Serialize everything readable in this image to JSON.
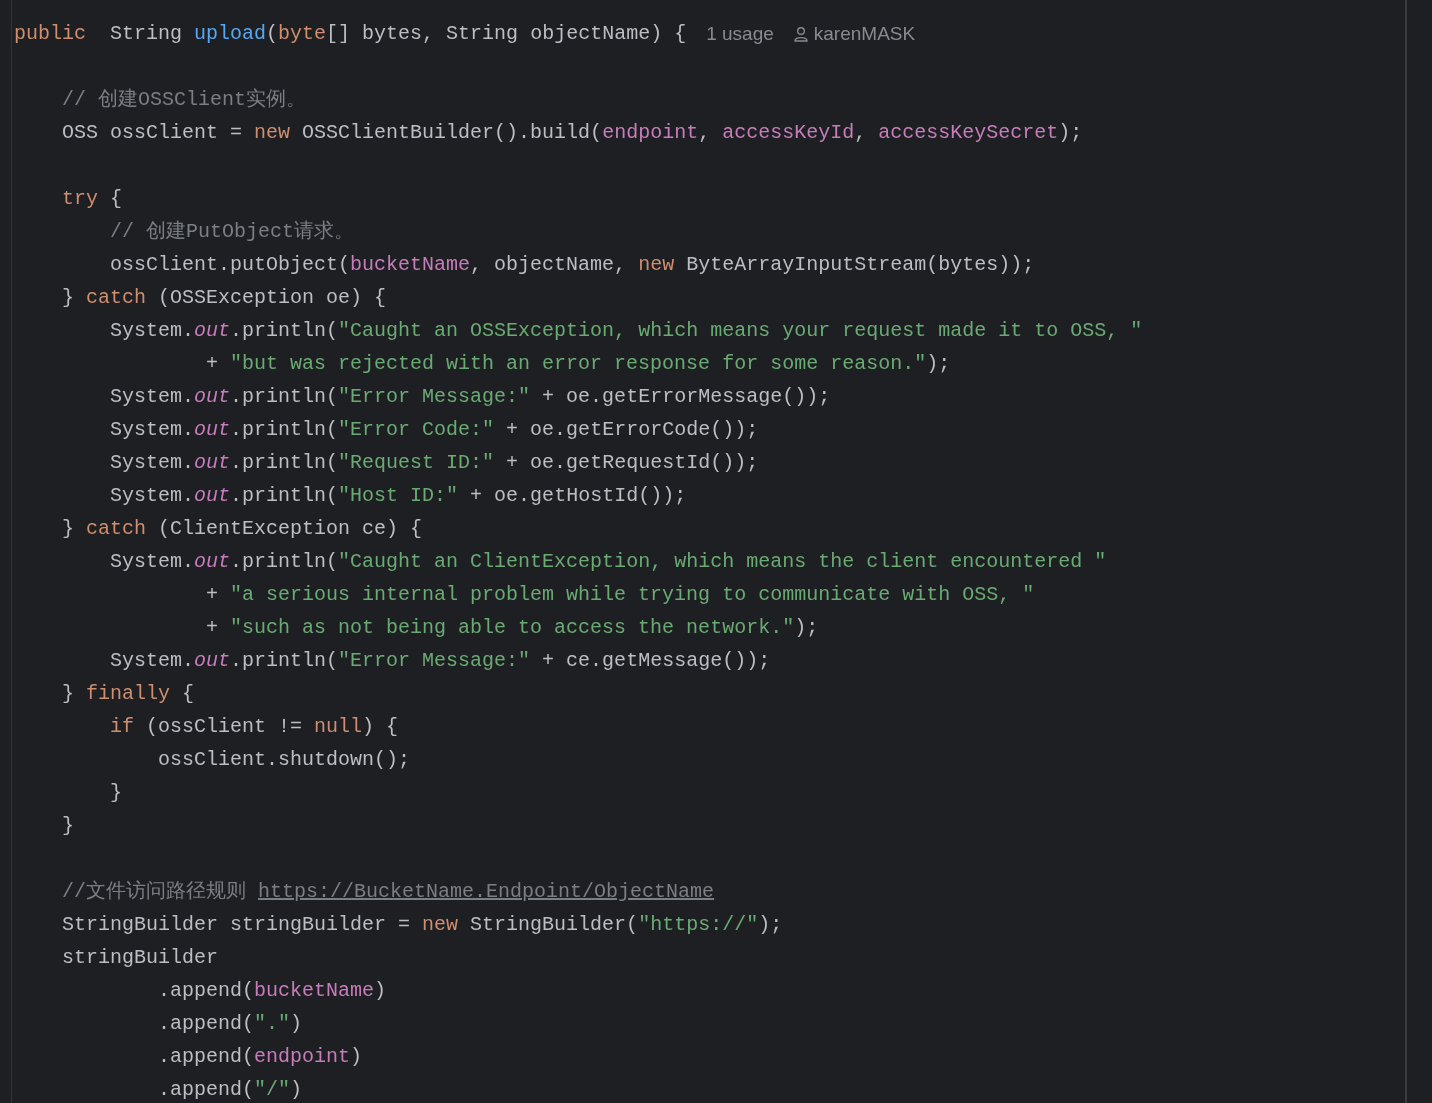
{
  "editor": {
    "blocks": [
      {
        "lines": [
          {
            "tokens": [
              {
                "kind": "keyword",
                "text": "public"
              },
              {
                "kind": "plain",
                "text": "  String "
              },
              {
                "kind": "method",
                "text": "upload"
              },
              {
                "kind": "plain",
                "text": "("
              },
              {
                "kind": "keyword",
                "text": "byte"
              },
              {
                "kind": "plain",
                "text": "[] bytes, String objectName) {"
              }
            ],
            "usage_hint": "1 usage",
            "author_hint": "karenMASK"
          }
        ]
      },
      {
        "lines": [
          {
            "tokens": [
              {
                "kind": "comment",
                "text": "    // 创建OSSClient实例。"
              }
            ]
          },
          {
            "tokens": [
              {
                "kind": "plain",
                "text": "    OSS ossClient = "
              },
              {
                "kind": "keyword",
                "text": "new"
              },
              {
                "kind": "plain",
                "text": " OSSClientBuilder().build("
              },
              {
                "kind": "field",
                "text": "endpoint"
              },
              {
                "kind": "plain",
                "text": ", "
              },
              {
                "kind": "field",
                "text": "accessKeyId"
              },
              {
                "kind": "plain",
                "text": ", "
              },
              {
                "kind": "field",
                "text": "accessKeySecret"
              },
              {
                "kind": "plain",
                "text": ");"
              }
            ]
          }
        ]
      },
      {
        "lines": [
          {
            "tokens": [
              {
                "kind": "keyword",
                "text": "    try"
              },
              {
                "kind": "plain",
                "text": " {"
              }
            ]
          },
          {
            "tokens": [
              {
                "kind": "comment",
                "text": "        // 创建PutObject请求。"
              }
            ]
          },
          {
            "tokens": [
              {
                "kind": "plain",
                "text": "        ossClient.putObject("
              },
              {
                "kind": "field",
                "text": "bucketName"
              },
              {
                "kind": "plain",
                "text": ", objectName, "
              },
              {
                "kind": "keyword",
                "text": "new"
              },
              {
                "kind": "plain",
                "text": " ByteArrayInputStream(bytes));"
              }
            ]
          },
          {
            "tokens": [
              {
                "kind": "plain",
                "text": "    } "
              },
              {
                "kind": "keyword",
                "text": "catch"
              },
              {
                "kind": "plain",
                "text": " (OSSException oe) {"
              }
            ]
          },
          {
            "tokens": [
              {
                "kind": "plain",
                "text": "        System."
              },
              {
                "kind": "static",
                "text": "out"
              },
              {
                "kind": "plain",
                "text": ".println("
              },
              {
                "kind": "string",
                "text": "\"Caught an OSSException, which means your request made it to OSS, \""
              }
            ]
          },
          {
            "tokens": [
              {
                "kind": "plain",
                "text": "                + "
              },
              {
                "kind": "string",
                "text": "\"but was rejected with an error response for some reason.\""
              },
              {
                "kind": "plain",
                "text": ");"
              }
            ]
          },
          {
            "tokens": [
              {
                "kind": "plain",
                "text": "        System."
              },
              {
                "kind": "static",
                "text": "out"
              },
              {
                "kind": "plain",
                "text": ".println("
              },
              {
                "kind": "string",
                "text": "\"Error Message:\""
              },
              {
                "kind": "plain",
                "text": " + oe.getErrorMessage());"
              }
            ]
          },
          {
            "tokens": [
              {
                "kind": "plain",
                "text": "        System."
              },
              {
                "kind": "static",
                "text": "out"
              },
              {
                "kind": "plain",
                "text": ".println("
              },
              {
                "kind": "string",
                "text": "\"Error Code:\""
              },
              {
                "kind": "plain",
                "text": " + oe.getErrorCode());"
              }
            ]
          },
          {
            "tokens": [
              {
                "kind": "plain",
                "text": "        System."
              },
              {
                "kind": "static",
                "text": "out"
              },
              {
                "kind": "plain",
                "text": ".println("
              },
              {
                "kind": "string",
                "text": "\"Request ID:\""
              },
              {
                "kind": "plain",
                "text": " + oe.getRequestId());"
              }
            ]
          },
          {
            "tokens": [
              {
                "kind": "plain",
                "text": "        System."
              },
              {
                "kind": "static",
                "text": "out"
              },
              {
                "kind": "plain",
                "text": ".println("
              },
              {
                "kind": "string",
                "text": "\"Host ID:\""
              },
              {
                "kind": "plain",
                "text": " + oe.getHostId());"
              }
            ]
          },
          {
            "tokens": [
              {
                "kind": "plain",
                "text": "    } "
              },
              {
                "kind": "keyword",
                "text": "catch"
              },
              {
                "kind": "plain",
                "text": " (ClientException ce) {"
              }
            ]
          },
          {
            "tokens": [
              {
                "kind": "plain",
                "text": "        System."
              },
              {
                "kind": "static",
                "text": "out"
              },
              {
                "kind": "plain",
                "text": ".println("
              },
              {
                "kind": "string",
                "text": "\"Caught an ClientException, which means the client encountered \""
              }
            ]
          },
          {
            "tokens": [
              {
                "kind": "plain",
                "text": "                + "
              },
              {
                "kind": "string",
                "text": "\"a serious internal problem while trying to communicate with OSS, \""
              }
            ]
          },
          {
            "tokens": [
              {
                "kind": "plain",
                "text": "                + "
              },
              {
                "kind": "string",
                "text": "\"such as not being able to access the network.\""
              },
              {
                "kind": "plain",
                "text": ");"
              }
            ]
          },
          {
            "tokens": [
              {
                "kind": "plain",
                "text": "        System."
              },
              {
                "kind": "static",
                "text": "out"
              },
              {
                "kind": "plain",
                "text": ".println("
              },
              {
                "kind": "string",
                "text": "\"Error Message:\""
              },
              {
                "kind": "plain",
                "text": " + ce.getMessage());"
              }
            ]
          },
          {
            "tokens": [
              {
                "kind": "plain",
                "text": "    } "
              },
              {
                "kind": "keyword",
                "text": "finally"
              },
              {
                "kind": "plain",
                "text": " {"
              }
            ]
          },
          {
            "tokens": [
              {
                "kind": "keyword",
                "text": "        if"
              },
              {
                "kind": "plain",
                "text": " (ossClient != "
              },
              {
                "kind": "keyword",
                "text": "null"
              },
              {
                "kind": "plain",
                "text": ") {"
              }
            ]
          },
          {
            "tokens": [
              {
                "kind": "plain",
                "text": "            ossClient.shutdown();"
              }
            ]
          },
          {
            "tokens": [
              {
                "kind": "plain",
                "text": "        }"
              }
            ]
          },
          {
            "tokens": [
              {
                "kind": "plain",
                "text": "    }"
              }
            ]
          }
        ]
      },
      {
        "lines": [
          {
            "tokens": [
              {
                "kind": "comment",
                "text": "    //文件访问路径规则 "
              },
              {
                "kind": "link",
                "text": "https://BucketName.Endpoint/ObjectName"
              }
            ]
          },
          {
            "tokens": [
              {
                "kind": "plain",
                "text": "    StringBuilder stringBuilder = "
              },
              {
                "kind": "keyword",
                "text": "new"
              },
              {
                "kind": "plain",
                "text": " StringBuilder("
              },
              {
                "kind": "string",
                "text": "\"https://\""
              },
              {
                "kind": "plain",
                "text": ");"
              }
            ]
          },
          {
            "tokens": [
              {
                "kind": "plain",
                "text": "    stringBuilder"
              }
            ]
          },
          {
            "tokens": [
              {
                "kind": "plain",
                "text": "            .append("
              },
              {
                "kind": "field",
                "text": "bucketName"
              },
              {
                "kind": "plain",
                "text": ")"
              }
            ]
          },
          {
            "tokens": [
              {
                "kind": "plain",
                "text": "            .append("
              },
              {
                "kind": "string",
                "text": "\".\""
              },
              {
                "kind": "plain",
                "text": ")"
              }
            ]
          },
          {
            "tokens": [
              {
                "kind": "plain",
                "text": "            .append("
              },
              {
                "kind": "field",
                "text": "endpoint"
              },
              {
                "kind": "plain",
                "text": ")"
              }
            ]
          },
          {
            "tokens": [
              {
                "kind": "plain",
                "text": "            .append("
              },
              {
                "kind": "string",
                "text": "\"/\""
              },
              {
                "kind": "plain",
                "text": ")"
              }
            ]
          }
        ]
      }
    ]
  }
}
